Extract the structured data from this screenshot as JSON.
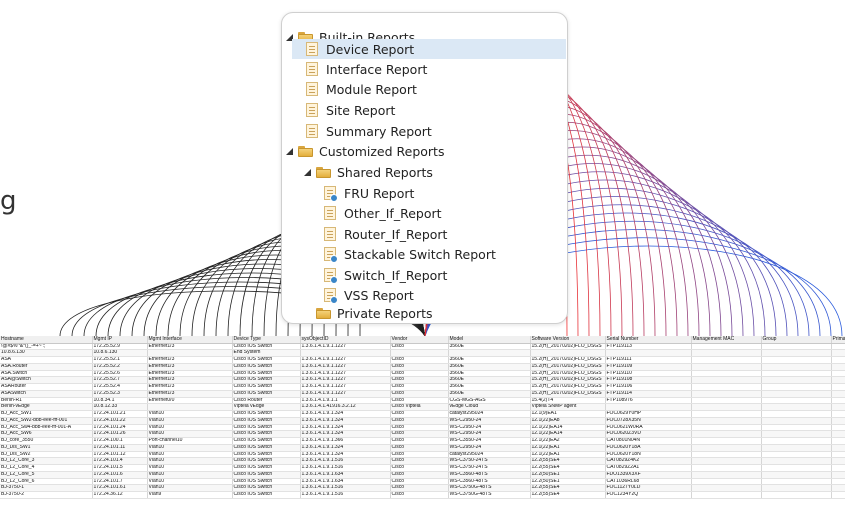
{
  "tree": {
    "builtin": {
      "label": "Built-in Reports",
      "items": [
        "Device Report",
        "Interface Report",
        "Module Report",
        "Site Report",
        "Summary Report"
      ],
      "selected": "Device Report"
    },
    "customized": {
      "label": "Customized Reports",
      "shared": {
        "label": "Shared Reports",
        "items": [
          "FRU Report",
          "Other_If_Report",
          "Router_If_Report",
          "Stackable Switch Report",
          "Switch_If_Report",
          "VSS Report"
        ]
      },
      "private_label": "Private Reports"
    }
  },
  "table": {
    "columns": [
      "Hostname",
      "Mgmt IP",
      "Mgmt Interface",
      "Device Type",
      "sysObjectID",
      "Vendor",
      "Model",
      "Software Version",
      "Serial Number",
      "Management MAC",
      "Group",
      "Primary Controller"
    ],
    "rows": [
      [
        "!@#$%^&*()_-=+~':;",
        "172.25.52.9",
        "Ethernet1/3",
        "Cisco IOS Switch",
        "1.3.6.1.4.1.9.1.1227",
        "Cisco",
        "3560E",
        "15.2(H)_20170202)FLO_DSGS",
        "FTP119113",
        "",
        "",
        ""
      ],
      [
        "10.8.6.130",
        "10.8.6.130",
        "",
        "End System",
        "",
        "",
        "",
        "",
        "",
        "",
        "",
        ""
      ],
      [
        "ASA",
        "172.25.52.1",
        "Ethernet1/3",
        "Cisco IOS Switch",
        "1.3.6.1.4.1.9.1.1227",
        "Cisco",
        "3560E",
        "15.2(H)_20170202)FLO_DSGS",
        "FTP119111",
        "",
        "",
        ""
      ],
      [
        "ASA.Router",
        "172.25.52.2",
        "Ethernet1/3",
        "Cisco IOS Switch",
        "1.3.6.1.4.1.9.1.1227",
        "Cisco",
        "3560E",
        "15.2(H)_20170202)FLO_DSGS",
        "FTP119109",
        "",
        "",
        ""
      ],
      [
        "ASA.Switch",
        "172.25.52.6",
        "Ethernet1/3",
        "Cisco IOS Switch",
        "1.3.6.1.4.1.9.1.1227",
        "Cisco",
        "3560E",
        "15.2(H)_20170202)FLO_DSGS",
        "FTP119110",
        "",
        "",
        ""
      ],
      [
        "ASA@Switch",
        "172.25.52.7",
        "Ethernet1/3",
        "Cisco IOS Switch",
        "1.3.6.1.4.1.9.1.1227",
        "Cisco",
        "3560E",
        "15.2(H)_20170202)FLO_DSGS",
        "FTP119108",
        "",
        "",
        ""
      ],
      [
        "ASARouter",
        "172.25.52.4",
        "Ethernet1/3",
        "Cisco IOS Switch",
        "1.3.6.1.4.1.9.1.1227",
        "Cisco",
        "3560E",
        "15.2(H)_20170202)FLO_DSGS",
        "FTP119106",
        "",
        "",
        ""
      ],
      [
        "ASASwitch",
        "172.25.52.3",
        "Ethernet1/3",
        "Cisco IOS Switch",
        "1.3.6.1.4.1.9.1.1227",
        "Cisco",
        "3560E",
        "15.2(H)_20170202)FLO_DSGS",
        "FTP119114",
        "",
        "",
        ""
      ],
      [
        "Berlin-R1",
        "10.8.34.1",
        "Ethernet0/0",
        "Cisco Router",
        "1.3.6.1.4.1.9.1.1",
        "Cisco",
        "CGS-MGS-AGS",
        "15.4(2)T4",
        "FTP108976",
        "",
        "",
        ""
      ],
      [
        "Berlin-vEdge",
        "10.8.12.33",
        "",
        "Viptela vEdge",
        "1.3.6.1.4.1.41916.3.2.12",
        "Cisco Viptela",
        "vEdge Cloud",
        "Viptela SNMP agent",
        "",
        "",
        "",
        ""
      ],
      [
        "BJ_Acc_SW1",
        "172.24.101.21",
        "Vlan10",
        "Cisco IOS Switch",
        "1.3.6.1.4.1.9.1.324",
        "Cisco",
        "catalyst295024",
        "12.1(9)EA1",
        "FOC0629Y0HP",
        "",
        "",
        ""
      ],
      [
        "BJ_Acc_SW2-bbb-eee-fff-001",
        "172.24.101.22",
        "Vlan10",
        "Cisco IOS Switch",
        "1.3.6.1.4.1.9.1.324",
        "Cisco",
        "WS-C2950-24",
        "12.1(22)EA8",
        "FOC0728X35N",
        "",
        "",
        ""
      ],
      [
        "BJ_Acc_Sw4-bbb-eee-fff-001-A",
        "172.24.101.24",
        "Vlan10",
        "Cisco IOS Switch",
        "1.3.6.1.4.1.9.1.324",
        "Cisco",
        "WS-C2950-24",
        "12.1(22)EA14",
        "FOC0621W0RA",
        "",
        "",
        ""
      ],
      [
        "BJ_Acc_SW6",
        "172.24.101.26",
        "Vlan10",
        "Cisco IOS Switch",
        "1.3.6.1.4.1.9.1.324",
        "Cisco",
        "WS-C2950-24",
        "12.1(22)EA14",
        "FOC0620Z3VD",
        "",
        "",
        ""
      ],
      [
        "BJ_core_3550",
        "172.24.100.1",
        "Port-channel10",
        "Cisco IOS Switch",
        "1.3.6.1.4.1.9.1.366",
        "Cisco",
        "WS-C3550-24",
        "12.1(22)EA2",
        "CAT0801N04N",
        "",
        "",
        ""
      ],
      [
        "BJ_Dis_SW1",
        "172.24.101.11",
        "Vlan10",
        "Cisco IOS Switch",
        "1.3.6.1.4.1.9.1.324",
        "Cisco",
        "WS-C2950-24",
        "12.1(22)EA1",
        "FOC0620Y18A",
        "",
        "",
        ""
      ],
      [
        "BJ_Dis_SW2",
        "172.24.101.12",
        "Vlan10",
        "Cisco IOS Switch",
        "1.3.6.1.4.1.9.1.324",
        "Cisco",
        "catalyst295024",
        "12.1(22)EA1",
        "FOC0620Y18N",
        "",
        "",
        ""
      ],
      [
        "BJ_L2_Core_3",
        "172.24.101.4",
        "Vlan10",
        "Cisco IOS Switch",
        "1.3.6.1.4.1.9.1.516",
        "Cisco",
        "WS-C3750-24TS",
        "12.2(55)SE4",
        "CAT0829Z4K2",
        "",
        "",
        ""
      ],
      [
        "BJ_L2_Core_4",
        "172.24.101.5",
        "Vlan10",
        "Cisco IOS Switch",
        "1.3.6.1.4.1.9.1.516",
        "Cisco",
        "WS-C3750-24TS",
        "12.2(55)SE4",
        "CAT0829Z2A1",
        "",
        "",
        ""
      ],
      [
        "BJ_L2_Core_5",
        "172.24.101.6",
        "Vlan10",
        "Cisco IOS Switch",
        "1.3.6.1.4.1.9.1.634",
        "Cisco",
        "WS-C3560-48TS",
        "12.2(50)SE1",
        "FDO1339X3XF",
        "",
        "",
        ""
      ],
      [
        "BJ_L2_Core_6",
        "172.24.101.7",
        "Vlan10",
        "Cisco IOS Switch",
        "1.3.6.1.4.1.9.1.634",
        "Cisco",
        "WS-C3560-48TS",
        "12.2(50)SE1",
        "CAT1036RL68",
        "",
        "",
        ""
      ],
      [
        "BJ-3750-1",
        "172.24.101.61",
        "Vlan10",
        "Cisco IOS Switch",
        "1.3.6.1.4.1.9.1.516",
        "Cisco",
        "WS-C3750G-48TS",
        "12.2(55)SE4",
        "FOC1127Y0LD",
        "",
        "",
        ""
      ],
      [
        "BJ-3750-2",
        "172.24.36.12",
        "Vlan9",
        "Cisco IOS Switch",
        "1.3.6.1.4.1.9.1.516",
        "Cisco",
        "WS-C3750G-48TS",
        "12.2(55)SE4",
        "FOC1234Y2Q",
        "",
        "",
        ""
      ]
    ]
  },
  "edge_text": "g",
  "colors": {
    "selection": "#dbe8f5",
    "folder": "#e3ae3c",
    "grid_line": "#d6d6d6",
    "header_bg": "#f0f0f0"
  }
}
